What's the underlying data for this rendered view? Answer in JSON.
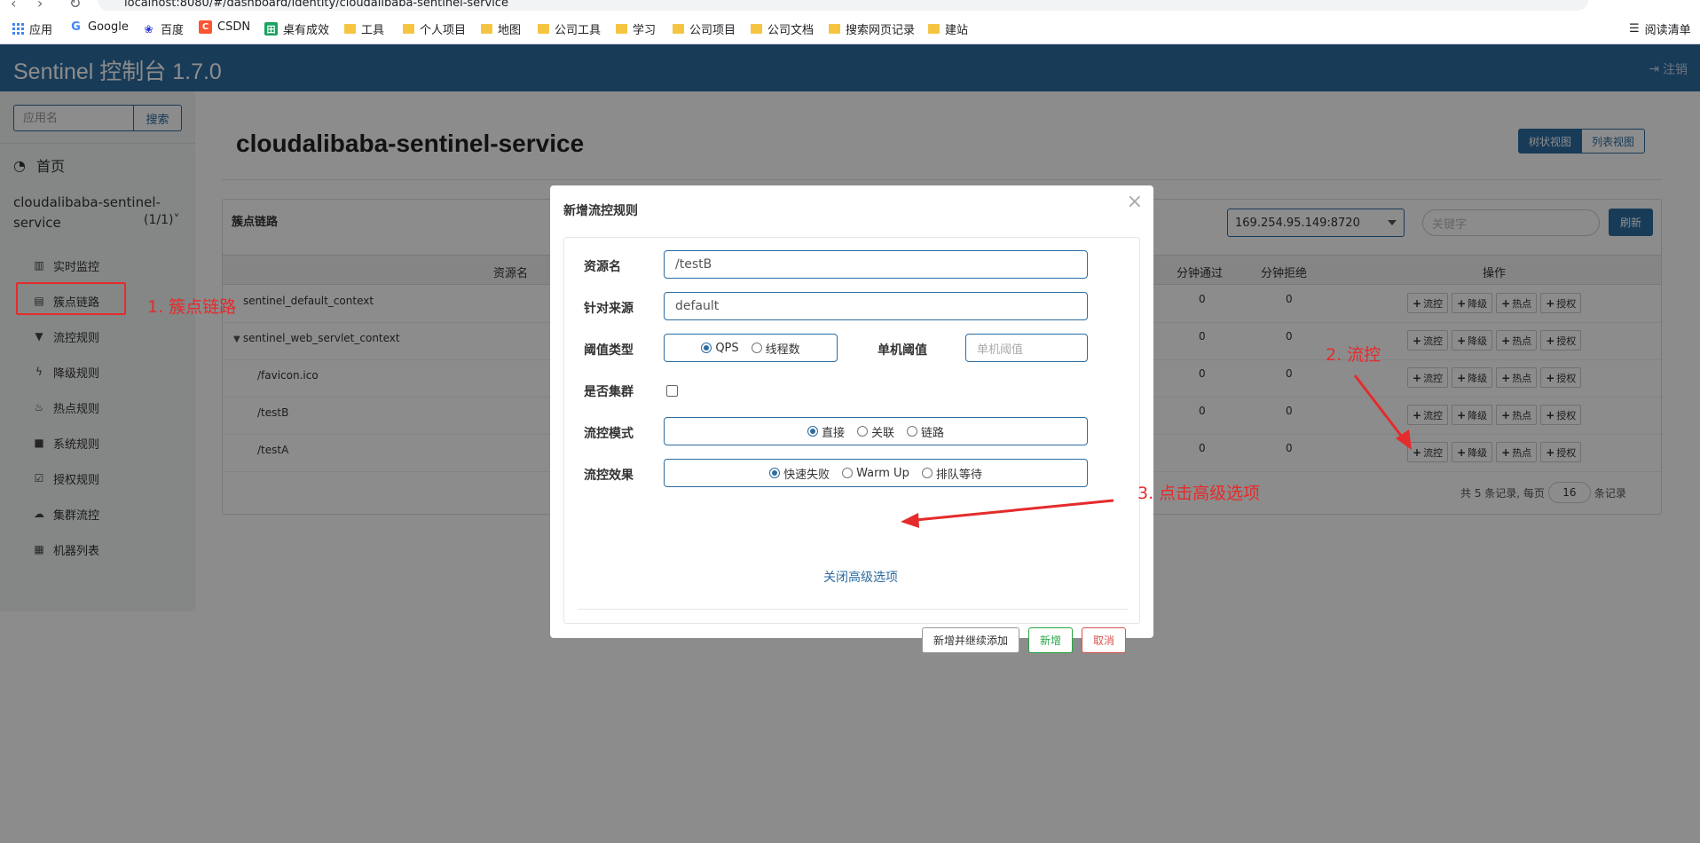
{
  "browser": {
    "url": "localhost:8080/#/dashboard/identity/cloudalibaba-sentinel-service",
    "bookmarks": [
      {
        "label": "应用",
        "icon": "apps-grid-icon"
      },
      {
        "label": "Google",
        "icon": "google-icon"
      },
      {
        "label": "百度",
        "icon": "baidu-icon"
      },
      {
        "label": "CSDN",
        "icon": "csdn-icon"
      },
      {
        "label": "桌有成效",
        "icon": "site-icon"
      },
      {
        "label": "工具",
        "icon": "folder-icon"
      },
      {
        "label": "个人项目",
        "icon": "folder-icon"
      },
      {
        "label": "地图",
        "icon": "folder-icon"
      },
      {
        "label": "公司工具",
        "icon": "folder-icon"
      },
      {
        "label": "学习",
        "icon": "folder-icon"
      },
      {
        "label": "公司项目",
        "icon": "folder-icon"
      },
      {
        "label": "公司文档",
        "icon": "folder-icon"
      },
      {
        "label": "搜索网页记录",
        "icon": "folder-icon"
      },
      {
        "label": "建站",
        "icon": "folder-icon"
      }
    ],
    "reading_list": "阅读清单"
  },
  "header": {
    "brand": "Sentinel 控制台 1.7.0",
    "logout": "注销"
  },
  "sidebar": {
    "search_placeholder": "应用名",
    "search_button": "搜索",
    "home": "首页",
    "app_name": "cloudalibaba-sentinel-service",
    "app_count": "(1/1)",
    "menu": [
      {
        "label": "实时监控",
        "icon": "bar-chart-icon"
      },
      {
        "label": "簇点链路",
        "icon": "list-icon"
      },
      {
        "label": "流控规则",
        "icon": "filter-icon"
      },
      {
        "label": "降级规则",
        "icon": "bolt-icon"
      },
      {
        "label": "热点规则",
        "icon": "fire-icon"
      },
      {
        "label": "系统规则",
        "icon": "lock-icon"
      },
      {
        "label": "授权规则",
        "icon": "check-icon"
      },
      {
        "label": "集群流控",
        "icon": "cloud-icon"
      },
      {
        "label": "机器列表",
        "icon": "table-icon"
      }
    ]
  },
  "main": {
    "title": "cloudalibaba-sentinel-service",
    "view_tree": "树状视图",
    "view_list": "列表视图",
    "panel_title": "簇点链路",
    "machine": "169.254.95.149:8720",
    "keyword_placeholder": "关键字",
    "refresh": "刷新",
    "columns": {
      "resource": "资源名",
      "pass": "分钟通过",
      "block": "分钟拒绝",
      "ops": "操作"
    },
    "rows": [
      {
        "name": "sentinel_default_context",
        "pass": "0",
        "block": "0"
      },
      {
        "name": "sentinel_web_servlet_context",
        "pass": "0",
        "block": "0"
      },
      {
        "name": "/favicon.ico",
        "pass": "0",
        "block": "0"
      },
      {
        "name": "/testB",
        "pass": "0",
        "block": "0"
      },
      {
        "name": "/testA",
        "pass": "0",
        "block": "0"
      }
    ],
    "ops": [
      "流控",
      "降级",
      "热点",
      "授权"
    ],
    "pager": {
      "prefix": "共 5 条记录, 每页",
      "size": "16",
      "suffix": "条记录"
    }
  },
  "modal": {
    "title": "新增流控规则",
    "close": "×",
    "resource_label": "资源名",
    "resource_value": "/testB",
    "origin_label": "针对来源",
    "origin_value": "default",
    "grade_label": "阈值类型",
    "grade_options": [
      "QPS",
      "线程数"
    ],
    "threshold_label": "单机阈值",
    "threshold_placeholder": "单机阈值",
    "cluster_label": "是否集群",
    "mode_label": "流控模式",
    "mode_options": [
      "直接",
      "关联",
      "链路"
    ],
    "effect_label": "流控效果",
    "effect_options": [
      "快速失败",
      "Warm Up",
      "排队等待"
    ],
    "advanced_link": "关闭高级选项",
    "btn_add_continue": "新增并继续添加",
    "btn_add": "新增",
    "btn_cancel": "取消"
  },
  "annotations": {
    "step1": "1. 簇点链路",
    "step2": "2. 流控",
    "step3": "3. 点击高级选项"
  },
  "colors": {
    "primary": "#2c6ca1",
    "annotation": "#e52b2b",
    "success": "#28a745",
    "danger": "#d9534f"
  }
}
